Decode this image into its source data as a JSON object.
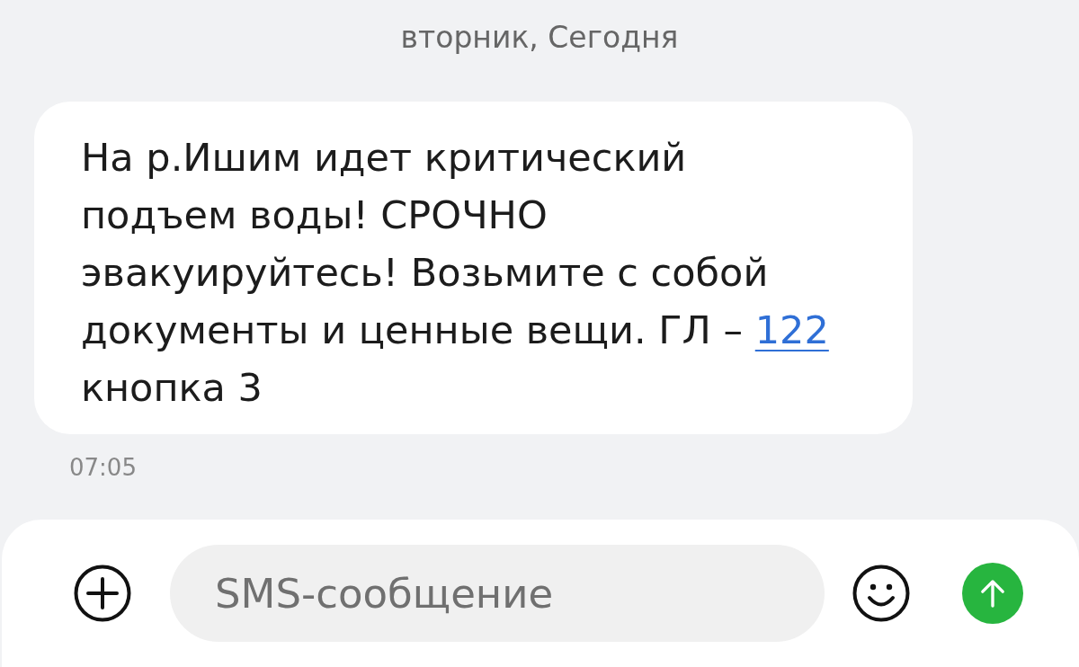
{
  "date_header": "вторник, Сегодня",
  "messages": [
    {
      "text_before": "На р.Ишим идет критический подъем воды! СРОЧНО эвакуируйтесь! Возьмите с собой документы и ценные вещи. ГЛ – ",
      "link": "122",
      "text_after": " кнопка 3",
      "time": "07:05"
    }
  ],
  "composer": {
    "placeholder": "SMS-сообщение"
  }
}
